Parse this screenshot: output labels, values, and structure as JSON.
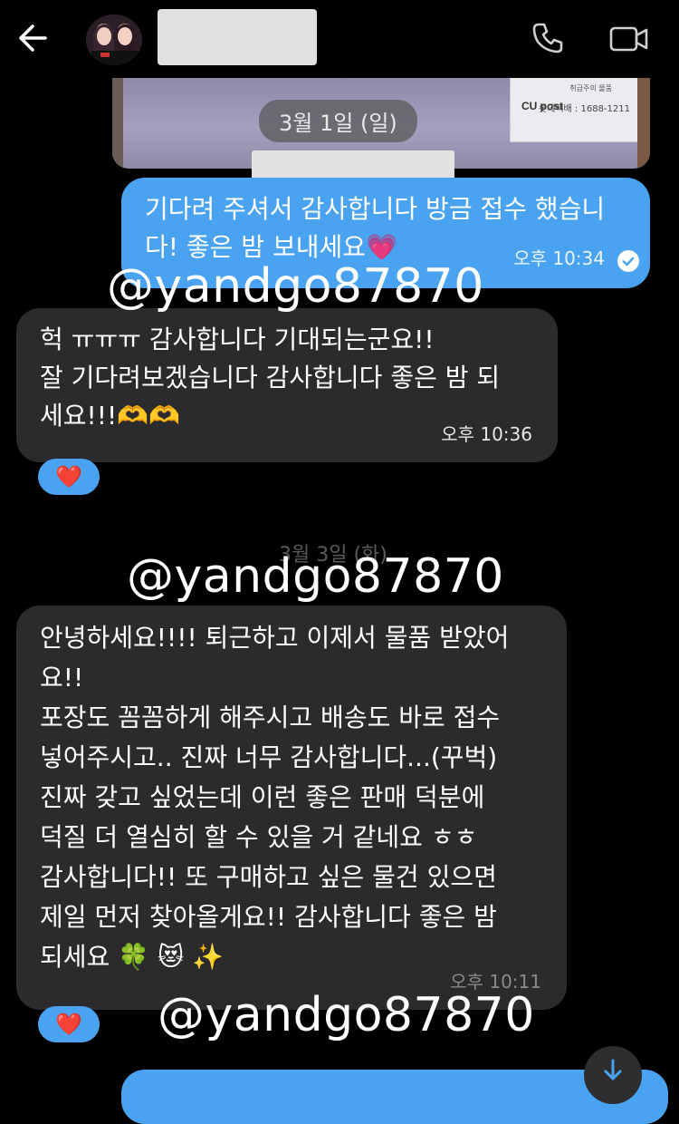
{
  "header": {
    "back_icon": "arrow-left-icon",
    "avatar_icon": "contact-avatar",
    "phone_icon": "phone-icon",
    "video_icon": "video-camera-icon"
  },
  "photo": {
    "label_small": "취급주의 물품",
    "brand": "CU post",
    "phone": "롯데택배 : 1688-1211"
  },
  "dates": {
    "first": "3월 1일 (일)",
    "second": "3월 3일 (화)"
  },
  "messages": [
    {
      "direction": "outgoing",
      "text": "기다려 주셔서 감사합니다 방금 접수 했습니\n다! 좋은 밤 보내세요💗",
      "time": "오후 10:34",
      "status_icon": "read-check-icon"
    },
    {
      "direction": "incoming",
      "text": "헉 ㅠㅠㅠ 감사합니다 기대되는군요!!\n잘 기다려보겠습니다 감사합니다 좋은 밤 되\n세요!!!🫶🫶",
      "time": "오후 10:36",
      "reaction": "❤️"
    },
    {
      "direction": "incoming",
      "text": "안녕하세요!!!! 퇴근하고 이제서 물품 받았어\n요!!\n포장도 꼼꼼하게 해주시고 배송도 바로 접수\n넣어주시고.. 진짜 너무 감사합니다...(꾸벅)\n진짜 갖고 싶었는데 이런 좋은 판매 덕분에\n덕질 더 열심히 할 수 있을 거 같네요 ㅎㅎ\n감사합니다!! 또 구매하고 싶은 물건 있으면\n제일 먼저 찾아올게요!! 감사합니다 좋은 밤\n되세요 🍀 😻 ✨",
      "time": "오후 10:11",
      "reaction": "❤️"
    }
  ],
  "watermark": "@yandgo87870",
  "colors": {
    "background": "#000000",
    "outgoing_bubble": "#4aa3f0",
    "incoming_bubble": "#2b2b2e",
    "reaction_bg": "#4aa3f0"
  },
  "scroll_button_icon": "arrow-down-icon"
}
